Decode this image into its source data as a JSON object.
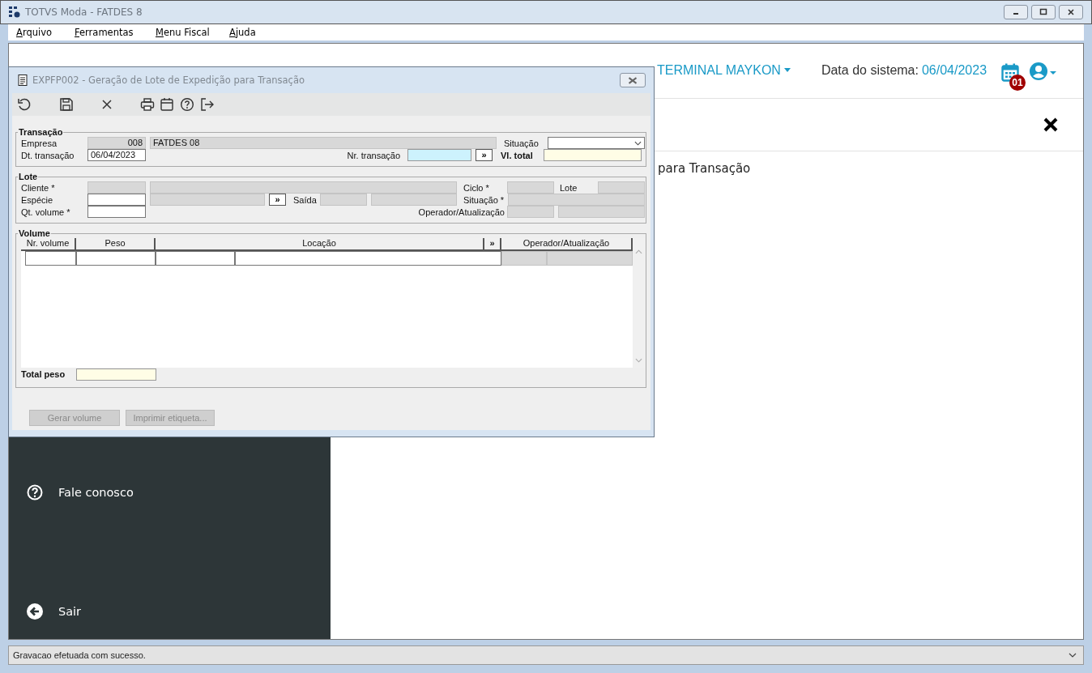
{
  "window": {
    "title": "TOTVS Moda - FATDES 8"
  },
  "menu": [
    {
      "label": "Arquivo"
    },
    {
      "label": "Ferramentas"
    },
    {
      "label": "Menu Fiscal"
    },
    {
      "label": "Ajuda"
    }
  ],
  "header": {
    "terminal": "TERMINAL MAYKON",
    "date_label": "Data do sistema:",
    "date": "06/04/2023",
    "badge": "01"
  },
  "page": {
    "heading": "para Transação"
  },
  "sidebar": {
    "items": [
      {
        "label": "Fale conosco",
        "kind": "help"
      },
      {
        "label": "Sair",
        "kind": "exit"
      }
    ]
  },
  "dialog": {
    "title": "EXPFP002 - Geração de Lote de Expedição para Transação",
    "transacao": {
      "title": "Transação",
      "empresa_label": "Empresa",
      "empresa_code": "008",
      "empresa_name": "FATDES 08",
      "situacao_label": "Situação",
      "dt_label": "Dt. transação",
      "dt_value": "06/04/2023",
      "nr_label": "Nr. transação",
      "lookup": "»",
      "total_label": "Vl. total"
    },
    "lote": {
      "title": "Lote",
      "cliente_label": "Cliente *",
      "especie_label": "Espécie",
      "qt_label": "Qt. volume *",
      "lookup": "»",
      "saida_label": "Saída",
      "ciclo_label": "Ciclo *",
      "lote_label": "Lote",
      "situacao_label": "Situação *",
      "operador_label": "Operador/Atualização"
    },
    "volume": {
      "title": "Volume",
      "columns": [
        "Nr. volume",
        "Peso",
        "Locação",
        "»",
        "Operador/Atualização"
      ],
      "total_label": "Total peso"
    },
    "buttons": [
      {
        "label": "Gerar volume",
        "disabled": true
      },
      {
        "label": "Imprimir etiqueta...",
        "disabled": true
      }
    ]
  },
  "status_bar": {
    "message": "Gravacao efetuada com sucesso."
  }
}
